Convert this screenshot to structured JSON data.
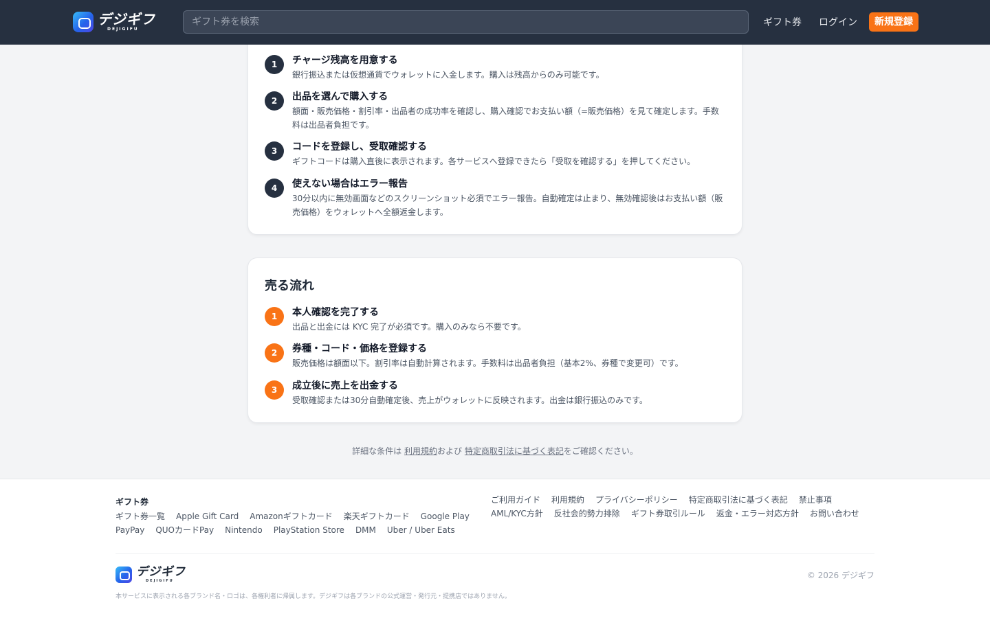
{
  "header": {
    "logo_text": "デジギフ",
    "logo_sub": "DEJIGIFU",
    "search_placeholder": "ギフト券を検索",
    "nav_gift": "ギフト券",
    "nav_login": "ログイン",
    "signup": "新規登録"
  },
  "buy_flow": {
    "steps": [
      {
        "num": "1",
        "title": "チャージ残高を用意する",
        "desc": "銀行振込または仮想通貨でウォレットに入金します。購入は残高からのみ可能です。"
      },
      {
        "num": "2",
        "title": "出品を選んで購入する",
        "desc": "額面・販売価格・割引率・出品者の成功率を確認し、購入確認でお支払い額（=販売価格）を見て確定します。手数料は出品者負担です。"
      },
      {
        "num": "3",
        "title": "コードを登録し、受取確認する",
        "desc": "ギフトコードは購入直後に表示されます。各サービスへ登録できたら「受取を確認する」を押してください。"
      },
      {
        "num": "4",
        "title": "使えない場合はエラー報告",
        "desc": "30分以内に無効画面などのスクリーンショット必須でエラー報告。自動確定は止まり、無効確認後はお支払い額（販売価格）をウォレットへ全額返金します。"
      }
    ]
  },
  "sell_flow": {
    "title": "売る流れ",
    "steps": [
      {
        "num": "1",
        "title": "本人確認を完了する",
        "desc": "出品と出金には KYC 完了が必須です。購入のみなら不要です。"
      },
      {
        "num": "2",
        "title": "券種・コード・価格を登録する",
        "desc": "販売価格は額面以下。割引率は自動計算されます。手数料は出品者負担（基本2%、券種で変更可）です。"
      },
      {
        "num": "3",
        "title": "成立後に売上を出金する",
        "desc": "受取確認または30分自動確定後、売上がウォレットに反映されます。出金は銀行振込のみです。"
      }
    ]
  },
  "note": {
    "prefix": "詳細な条件は ",
    "terms_link": "利用規約",
    "middle": "および ",
    "tokusho_link": "特定商取引法に基づく表記",
    "suffix": "をご確認ください。"
  },
  "footer": {
    "heading": "ギフト券",
    "gift_links": [
      "ギフト券一覧",
      "Apple Gift Card",
      "Amazonギフトカード",
      "楽天ギフトカード",
      "Google Play",
      "PayPay",
      "QUOカードPay",
      "Nintendo",
      "PlayStation Store",
      "DMM",
      "Uber / Uber Eats"
    ],
    "info_links": [
      "ご利用ガイド",
      "利用規約",
      "プライバシーポリシー",
      "特定商取引法に基づく表記",
      "禁止事項",
      "AML/KYC方針",
      "反社会的勢力排除",
      "ギフト券取引ルール",
      "返金・エラー対応方針",
      "お問い合わせ"
    ],
    "logo_text": "デジギフ",
    "logo_sub": "DEJIGIFU",
    "copyright": "© 2026 デジギフ",
    "disclaimer": "本サービスに表示される各ブランド名・ロゴは、各権利者に帰属します。デジギフは各ブランドの公式運営・発行元・提携店ではありません。"
  },
  "colors": {
    "header_bg": "#263040",
    "accent": "#f97316",
    "step_dark": "#263040",
    "page_bg": "#f3f4f6"
  }
}
